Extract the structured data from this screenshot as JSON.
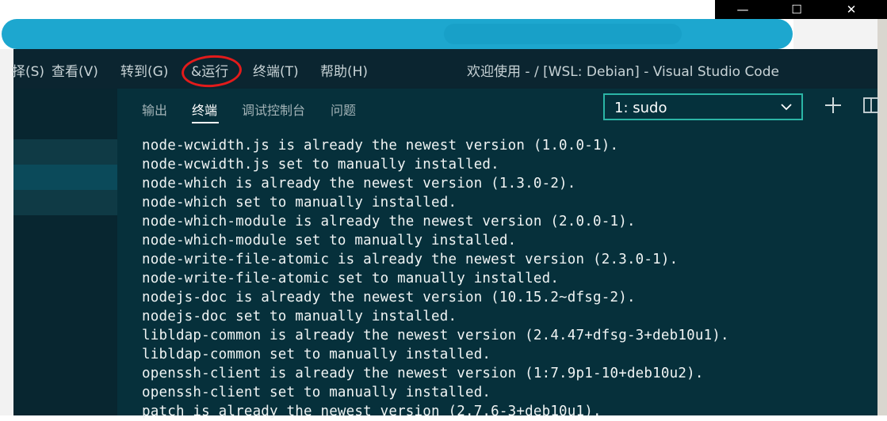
{
  "window_controls": {
    "minimize": "—",
    "maximize": "☐",
    "close": "✕"
  },
  "menubar": {
    "items": [
      "择(S)",
      "查看(V)",
      "转到(G)",
      "&运行",
      "终端(T)",
      "帮助(H)"
    ],
    "title": "欢迎使用 - / [WSL: Debian] - Visual Studio Code"
  },
  "panel": {
    "tabs": [
      "输出",
      "终端",
      "调试控制台",
      "问题"
    ],
    "active_tab": "终端",
    "terminal_select": {
      "value": "1: sudo"
    }
  },
  "terminal": {
    "lines": [
      "node-wcwidth.js is already the newest version (1.0.0-1).",
      "node-wcwidth.js set to manually installed.",
      "node-which is already the newest version (1.3.0-2).",
      "node-which set to manually installed.",
      "node-which-module is already the newest version (2.0.0-1).",
      "node-which-module set to manually installed.",
      "node-write-file-atomic is already the newest version (2.3.0-1).",
      "node-write-file-atomic set to manually installed.",
      "nodejs-doc is already the newest version (10.15.2~dfsg-2).",
      "nodejs-doc set to manually installed.",
      "libldap-common is already the newest version (2.4.47+dfsg-3+deb10u1).",
      "libldap-common set to manually installed.",
      "openssh-client is already the newest version (1:7.9p1-10+deb10u2).",
      "openssh-client set to manually installed.",
      "patch is already the newest version (2.7.6-3+deb10u1)."
    ]
  },
  "colors": {
    "annotation_circle": "#e31b1b",
    "redaction": "#1da7cf",
    "select_border": "#2bb5a6"
  }
}
